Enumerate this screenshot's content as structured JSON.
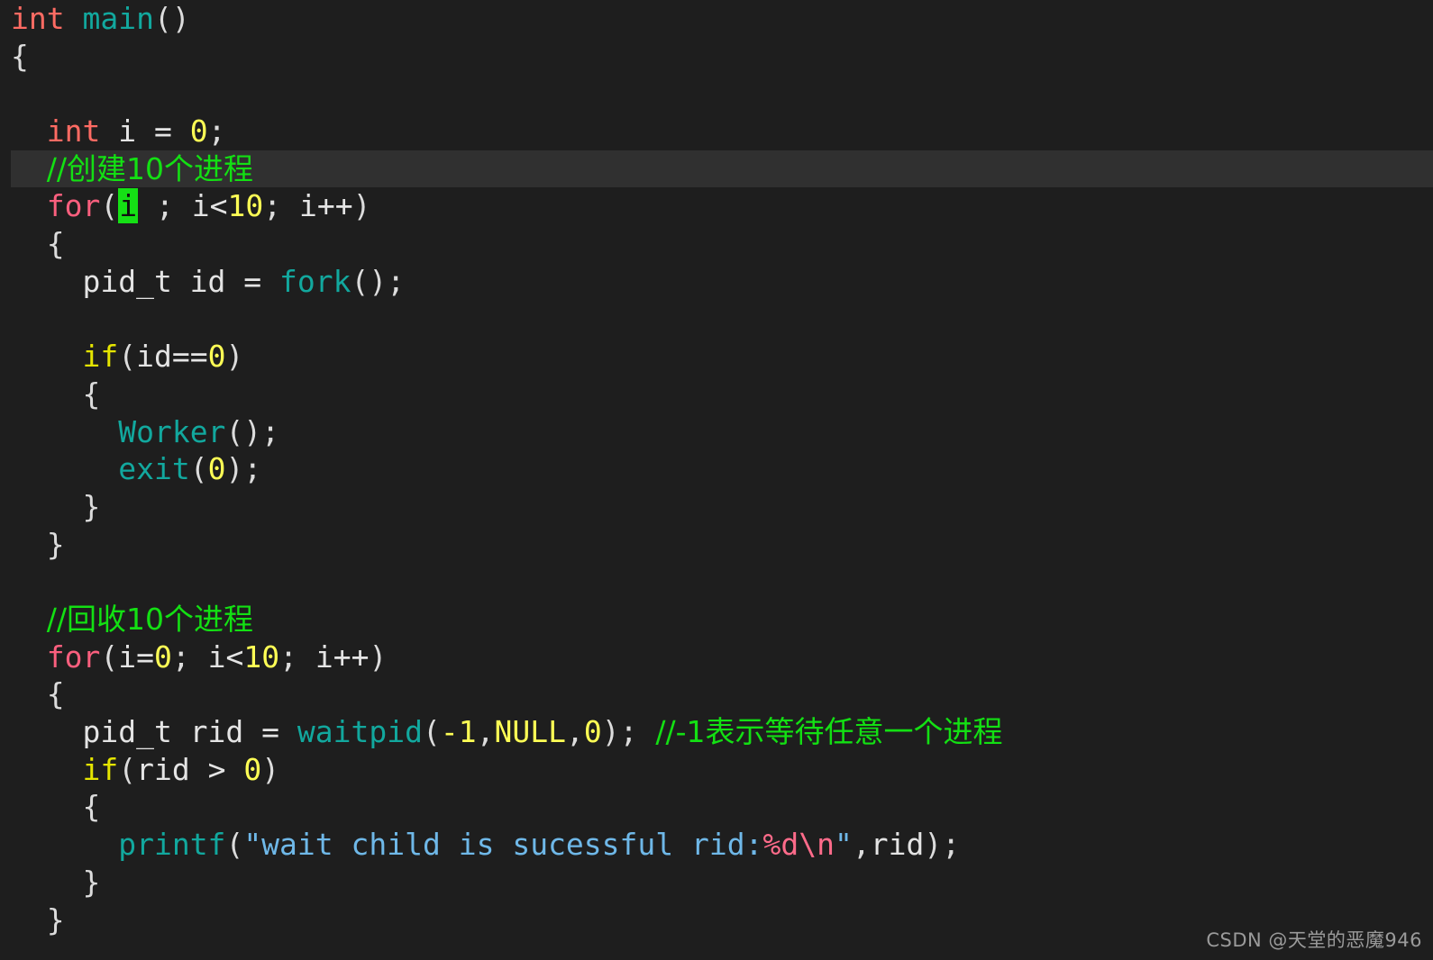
{
  "editor": {
    "background": "#1e1e1e",
    "highlight_line_background": "#303030",
    "cursor_color": "#15e015",
    "default_text_color": "#e4e4e4",
    "language": "C",
    "highlighted_line_index": 4,
    "cursor_char": "i"
  },
  "palette": {
    "type_keyword": "#ff6b63",
    "loop_keyword": "#fa5f7e",
    "cond_keyword": "#e5e500",
    "function": "#12a89e",
    "number": "#ffff55",
    "comment": "#13e013",
    "string": "#6fb8e8",
    "escape": "#ff6b8a",
    "plain": "#e4e4e4"
  },
  "lines": [
    {
      "id": "line-1",
      "tokens": [
        {
          "cls": "t-type",
          "text": "int"
        },
        {
          "cls": "t-plain",
          "text": " "
        },
        {
          "cls": "t-fn",
          "text": "main"
        },
        {
          "cls": "t-punct",
          "text": "()"
        }
      ]
    },
    {
      "id": "line-2",
      "tokens": [
        {
          "cls": "t-punct",
          "text": "{"
        }
      ]
    },
    {
      "id": "line-3",
      "tokens": []
    },
    {
      "id": "line-4",
      "tokens": [
        {
          "cls": "t-plain",
          "text": "  "
        },
        {
          "cls": "t-type",
          "text": "int"
        },
        {
          "cls": "t-plain",
          "text": " i = "
        },
        {
          "cls": "t-num",
          "text": "0"
        },
        {
          "cls": "t-punct",
          "text": ";"
        }
      ]
    },
    {
      "id": "line-5",
      "tokens": [
        {
          "cls": "t-plain",
          "text": "  "
        },
        {
          "cls": "t-comment",
          "text": "//创建10个进程"
        }
      ]
    },
    {
      "id": "line-6",
      "tokens": [
        {
          "cls": "t-plain",
          "text": "  "
        },
        {
          "cls": "t-kw",
          "text": "for"
        },
        {
          "cls": "t-punct",
          "text": "("
        },
        {
          "cls": "cursor",
          "text": "i"
        },
        {
          "cls": "t-plain",
          "text": " "
        },
        {
          "cls": "t-punct",
          "text": ";"
        },
        {
          "cls": "t-plain",
          "text": " i<"
        },
        {
          "cls": "t-num",
          "text": "10"
        },
        {
          "cls": "t-punct",
          "text": ";"
        },
        {
          "cls": "t-plain",
          "text": " i++"
        },
        {
          "cls": "t-punct",
          "text": ")"
        }
      ]
    },
    {
      "id": "line-7",
      "tokens": [
        {
          "cls": "t-plain",
          "text": "  "
        },
        {
          "cls": "t-punct",
          "text": "{"
        }
      ]
    },
    {
      "id": "line-8",
      "tokens": [
        {
          "cls": "t-plain",
          "text": "    pid_t id = "
        },
        {
          "cls": "t-fn",
          "text": "fork"
        },
        {
          "cls": "t-punct",
          "text": "();"
        }
      ]
    },
    {
      "id": "line-9",
      "tokens": []
    },
    {
      "id": "line-10",
      "tokens": [
        {
          "cls": "t-plain",
          "text": "    "
        },
        {
          "cls": "t-cond",
          "text": "if"
        },
        {
          "cls": "t-punct",
          "text": "("
        },
        {
          "cls": "t-plain",
          "text": "id=="
        },
        {
          "cls": "t-num",
          "text": "0"
        },
        {
          "cls": "t-punct",
          "text": ")"
        }
      ]
    },
    {
      "id": "line-11",
      "tokens": [
        {
          "cls": "t-plain",
          "text": "    "
        },
        {
          "cls": "t-punct",
          "text": "{"
        }
      ]
    },
    {
      "id": "line-12",
      "tokens": [
        {
          "cls": "t-plain",
          "text": "      "
        },
        {
          "cls": "t-fn",
          "text": "Worker"
        },
        {
          "cls": "t-punct",
          "text": "();"
        }
      ]
    },
    {
      "id": "line-13",
      "tokens": [
        {
          "cls": "t-plain",
          "text": "      "
        },
        {
          "cls": "t-fn",
          "text": "exit"
        },
        {
          "cls": "t-punct",
          "text": "("
        },
        {
          "cls": "t-num",
          "text": "0"
        },
        {
          "cls": "t-punct",
          "text": ");"
        }
      ]
    },
    {
      "id": "line-14",
      "tokens": [
        {
          "cls": "t-plain",
          "text": "    "
        },
        {
          "cls": "t-punct",
          "text": "}"
        }
      ]
    },
    {
      "id": "line-15",
      "tokens": [
        {
          "cls": "t-plain",
          "text": "  "
        },
        {
          "cls": "t-punct",
          "text": "}"
        }
      ]
    },
    {
      "id": "line-16",
      "tokens": []
    },
    {
      "id": "line-17",
      "tokens": [
        {
          "cls": "t-plain",
          "text": "  "
        },
        {
          "cls": "t-comment",
          "text": "//回收10个进程"
        }
      ]
    },
    {
      "id": "line-18",
      "tokens": [
        {
          "cls": "t-plain",
          "text": "  "
        },
        {
          "cls": "t-kw",
          "text": "for"
        },
        {
          "cls": "t-punct",
          "text": "("
        },
        {
          "cls": "t-plain",
          "text": "i="
        },
        {
          "cls": "t-num",
          "text": "0"
        },
        {
          "cls": "t-punct",
          "text": ";"
        },
        {
          "cls": "t-plain",
          "text": " i<"
        },
        {
          "cls": "t-num",
          "text": "10"
        },
        {
          "cls": "t-punct",
          "text": ";"
        },
        {
          "cls": "t-plain",
          "text": " i++"
        },
        {
          "cls": "t-punct",
          "text": ")"
        }
      ]
    },
    {
      "id": "line-19",
      "tokens": [
        {
          "cls": "t-plain",
          "text": "  "
        },
        {
          "cls": "t-punct",
          "text": "{"
        }
      ]
    },
    {
      "id": "line-20",
      "tokens": [
        {
          "cls": "t-plain",
          "text": "    pid_t rid = "
        },
        {
          "cls": "t-fn",
          "text": "waitpid"
        },
        {
          "cls": "t-punct",
          "text": "("
        },
        {
          "cls": "t-num",
          "text": "-1"
        },
        {
          "cls": "t-punct",
          "text": ","
        },
        {
          "cls": "t-num",
          "text": "NULL"
        },
        {
          "cls": "t-punct",
          "text": ","
        },
        {
          "cls": "t-num",
          "text": "0"
        },
        {
          "cls": "t-punct",
          "text": ");"
        },
        {
          "cls": "t-plain",
          "text": " "
        },
        {
          "cls": "t-comment",
          "text": "//-1表示等待任意一个进程"
        }
      ]
    },
    {
      "id": "line-21",
      "tokens": [
        {
          "cls": "t-plain",
          "text": "    "
        },
        {
          "cls": "t-cond",
          "text": "if"
        },
        {
          "cls": "t-punct",
          "text": "("
        },
        {
          "cls": "t-plain",
          "text": "rid > "
        },
        {
          "cls": "t-num",
          "text": "0"
        },
        {
          "cls": "t-punct",
          "text": ")"
        }
      ]
    },
    {
      "id": "line-22",
      "tokens": [
        {
          "cls": "t-plain",
          "text": "    "
        },
        {
          "cls": "t-punct",
          "text": "{"
        }
      ]
    },
    {
      "id": "line-23",
      "tokens": [
        {
          "cls": "t-plain",
          "text": "      "
        },
        {
          "cls": "t-fn",
          "text": "printf"
        },
        {
          "cls": "t-punct",
          "text": "("
        },
        {
          "cls": "t-string",
          "text": "\"wait child is sucessful rid:"
        },
        {
          "cls": "t-esc",
          "text": "%d\\n"
        },
        {
          "cls": "t-string",
          "text": "\""
        },
        {
          "cls": "t-punct",
          "text": ","
        },
        {
          "cls": "t-plain",
          "text": "rid"
        },
        {
          "cls": "t-punct",
          "text": ");"
        }
      ]
    },
    {
      "id": "line-24",
      "tokens": [
        {
          "cls": "t-plain",
          "text": "    "
        },
        {
          "cls": "t-punct",
          "text": "}"
        }
      ]
    },
    {
      "id": "line-25",
      "tokens": [
        {
          "cls": "t-plain",
          "text": "  "
        },
        {
          "cls": "t-punct",
          "text": "}"
        }
      ]
    }
  ],
  "watermark": {
    "text": "CSDN @天堂的恶魔946"
  }
}
